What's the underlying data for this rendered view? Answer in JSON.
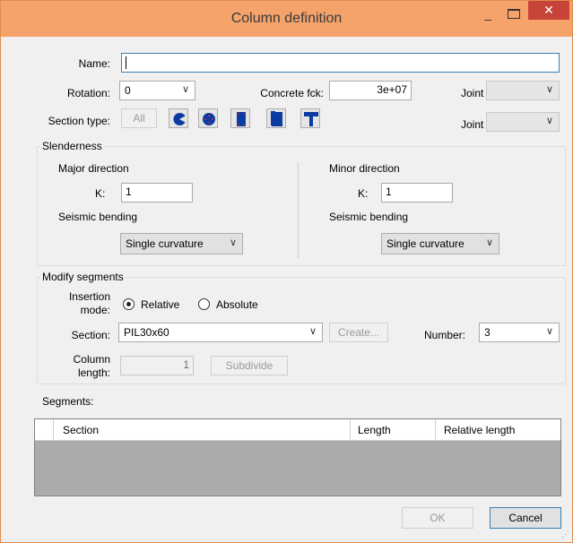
{
  "window": {
    "title": "Column definition",
    "minimize_glyph": "–",
    "close_glyph": "✕"
  },
  "form": {
    "name_label": "Name:",
    "name_value": "",
    "rotation_label": "Rotation:",
    "rotation_value": "0",
    "concrete_label": "Concrete fck:",
    "concrete_value": "3e+07",
    "joint_i_label": "Joint I:",
    "joint_i_value": "",
    "joint_j_label": "Joint J:",
    "joint_j_value": "",
    "section_type_label": "Section type:",
    "section_type_all": "All",
    "section_type_icons": [
      "circle-sector-icon",
      "circle-icon",
      "rectangle-icon",
      "l-section-icon",
      "l-section-alt-icon",
      "t-section-icon"
    ]
  },
  "slenderness": {
    "title": "Slenderness",
    "major": {
      "title": "Major direction",
      "k_label": "K:",
      "k_value": "1",
      "seismic_label": "Seismic bending",
      "curvature_value": "Single curvature"
    },
    "minor": {
      "title": "Minor direction",
      "k_label": "K:",
      "k_value": "1",
      "seismic_label": "Seismic bending",
      "curvature_value": "Single curvature"
    }
  },
  "modify": {
    "title": "Modify segments",
    "insertion_label_1": "Insertion",
    "insertion_label_2": "mode:",
    "relative_label": "Relative",
    "absolute_label": "Absolute",
    "selected_mode": "Relative",
    "section_label": "Section:",
    "section_value": "PIL30x60",
    "create_label": "Create...",
    "number_label": "Number:",
    "number_value": "3",
    "length_label_1": "Column",
    "length_label_2": "length:",
    "length_value": "1",
    "subdivide_label": "Subdivide"
  },
  "segments": {
    "label": "Segments:",
    "columns": [
      "Section",
      "Length",
      "Relative length"
    ],
    "rows": []
  },
  "footer": {
    "ok_label": "OK",
    "cancel_label": "Cancel"
  },
  "colors": {
    "titlebar": "#f5a26b",
    "close": "#c74337",
    "icon_blue": "#0b3aa3"
  }
}
